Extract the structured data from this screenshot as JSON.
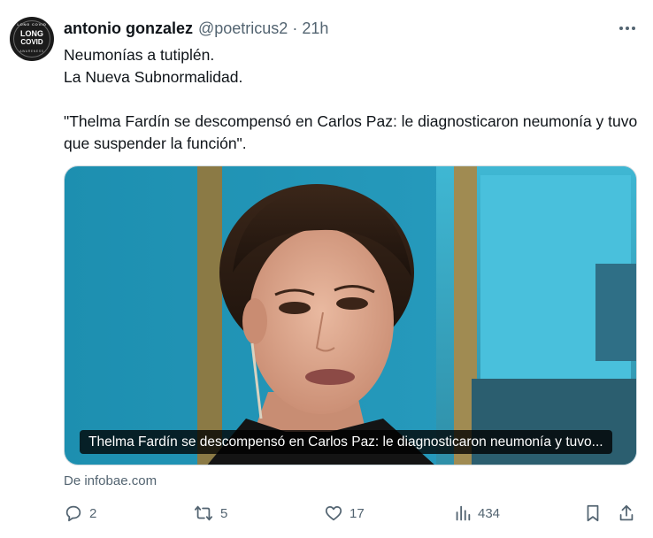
{
  "author": {
    "display_name": "antonio gonzalez",
    "handle": "@poetricus2",
    "separator": "·",
    "time": "21h",
    "avatar": {
      "line1": "LONG",
      "line2": "COVID",
      "arc_top": "LONG COVID",
      "arc_bottom": "AWARENESS"
    }
  },
  "more_icon": "ellipsis-icon",
  "tweet_text": [
    "Neumonías a tutiplén.",
    "La Nueva Subnormalidad.",
    "",
    "\"Thelma Fardín se descompensó en Carlos Paz: le diagnosticaron neumonía y tuvo que suspender la función\"."
  ],
  "card": {
    "caption": "Thelma Fardín se descompensó en Carlos Paz: le diagnosticaron neumonía y tuvo...",
    "source": "De infobae.com"
  },
  "actions": {
    "reply": {
      "icon": "reply-icon",
      "count": "2"
    },
    "retweet": {
      "icon": "retweet-icon",
      "count": "5"
    },
    "like": {
      "icon": "heart-icon",
      "count": "17"
    },
    "views": {
      "icon": "views-icon",
      "count": "434"
    },
    "bookmark": {
      "icon": "bookmark-icon"
    },
    "share": {
      "icon": "share-icon"
    }
  },
  "colors": {
    "text": "#0f1419",
    "muted": "#536471",
    "border": "#cfd9de"
  }
}
